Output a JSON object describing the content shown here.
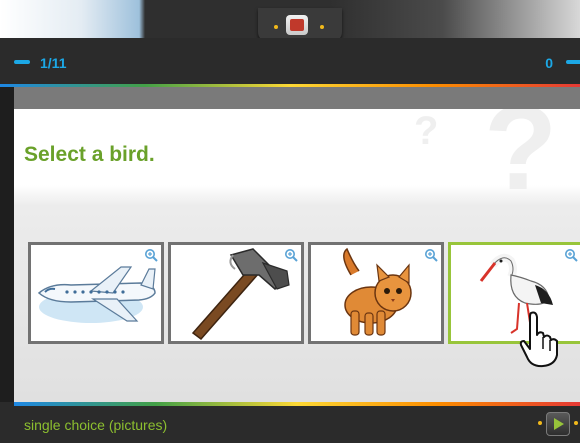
{
  "header": {
    "progress": "1/11",
    "score": "0"
  },
  "question": {
    "text": "Select a bird."
  },
  "answers": [
    {
      "name": "airplane",
      "icon": "airplane-image",
      "selected": false
    },
    {
      "name": "hammer",
      "icon": "hammer-image",
      "selected": false
    },
    {
      "name": "cat",
      "icon": "cat-image",
      "selected": false
    },
    {
      "name": "stork",
      "icon": "stork-image",
      "selected": true
    }
  ],
  "footer": {
    "mode": "single choice (pictures)",
    "next_icon": "play-arrow-icon"
  },
  "colors": {
    "accent_blue": "#1ca8e6",
    "accent_green": "#6aa12a",
    "selected_border": "#98c53a",
    "dark_bar": "#2b2b2b"
  }
}
